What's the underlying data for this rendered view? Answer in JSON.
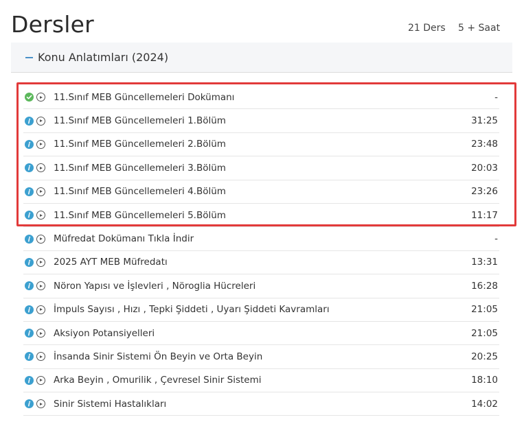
{
  "page": {
    "title": "Dersler",
    "lesson_count": "21 Ders",
    "hours": "5 + Saat"
  },
  "section": {
    "title": "Konu Anlatımları (2024)"
  },
  "lessons": [
    {
      "title": "11.Sınıf MEB Güncellemeleri Dokümanı",
      "duration": "-",
      "status": "check-icon"
    },
    {
      "title": "11.Sınıf MEB Güncellemeleri 1.Bölüm",
      "duration": "31:25",
      "status": "info-icon"
    },
    {
      "title": "11.Sınıf MEB Güncellemeleri 2.Bölüm",
      "duration": "23:48",
      "status": "info-icon"
    },
    {
      "title": "11.Sınıf MEB Güncellemeleri 3.Bölüm",
      "duration": "20:03",
      "status": "info-icon"
    },
    {
      "title": "11.Sınıf MEB Güncellemeleri 4.Bölüm",
      "duration": "23:26",
      "status": "info-icon"
    },
    {
      "title": "11.Sınıf MEB Güncellemeleri 5.Bölüm",
      "duration": "11:17",
      "status": "info-icon"
    },
    {
      "title": "Müfredat Dokümanı Tıkla İndir",
      "duration": "-",
      "status": "info-icon"
    },
    {
      "title": "2025 AYT MEB Müfredatı",
      "duration": "13:31",
      "status": "info-icon"
    },
    {
      "title": "Nöron Yapısı ve İşlevleri , Nöroglia Hücreleri",
      "duration": "16:28",
      "status": "info-icon"
    },
    {
      "title": "İmpuls Sayısı , Hızı , Tepki Şiddeti , Uyarı Şiddeti Kavramları",
      "duration": "21:05",
      "status": "info-icon"
    },
    {
      "title": "Aksiyon Potansiyelleri",
      "duration": "21:05",
      "status": "info-icon"
    },
    {
      "title": "İnsanda Sinir Sistemi Ön Beyin ve Orta Beyin",
      "duration": "20:25",
      "status": "info-icon"
    },
    {
      "title": "Arka Beyin , Omurilik , Çevresel Sinir Sistemi",
      "duration": "18:10",
      "status": "info-icon"
    },
    {
      "title": "Sinir Sistemi Hastalıkları",
      "duration": "14:02",
      "status": "info-icon"
    }
  ],
  "colors": {
    "highlight": "#e23a3a",
    "check": "#5cb85c",
    "info": "#3ca0d0",
    "accent": "#4a90c8"
  }
}
